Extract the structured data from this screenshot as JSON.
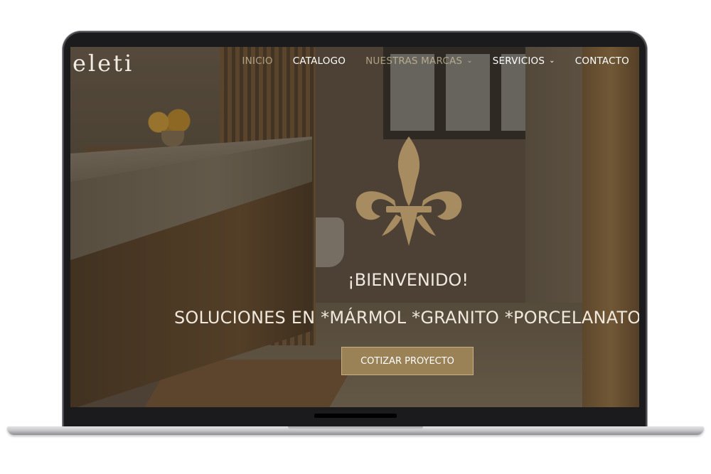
{
  "brand": {
    "logo_text": "eleti",
    "accent_color": "#9a8156",
    "emblem_color": "#a68c60"
  },
  "nav": {
    "items": [
      {
        "label": "INICIO"
      },
      {
        "label": "CATALOGO"
      },
      {
        "label": "NUESTRAS MARCAS"
      },
      {
        "label": "SERVICIOS"
      },
      {
        "label": "CONTACTO"
      }
    ]
  },
  "hero": {
    "welcome": "¡BIENVENIDO!",
    "tagline": "SOLUCIONES EN *MÁRMOL *GRANITO *PORCELANATO",
    "cta_label": "COTIZAR PROYECTO",
    "emblem_icon": "fleur-de-lis-icon"
  },
  "icons": {
    "dropdown": "chevron-down-icon"
  }
}
